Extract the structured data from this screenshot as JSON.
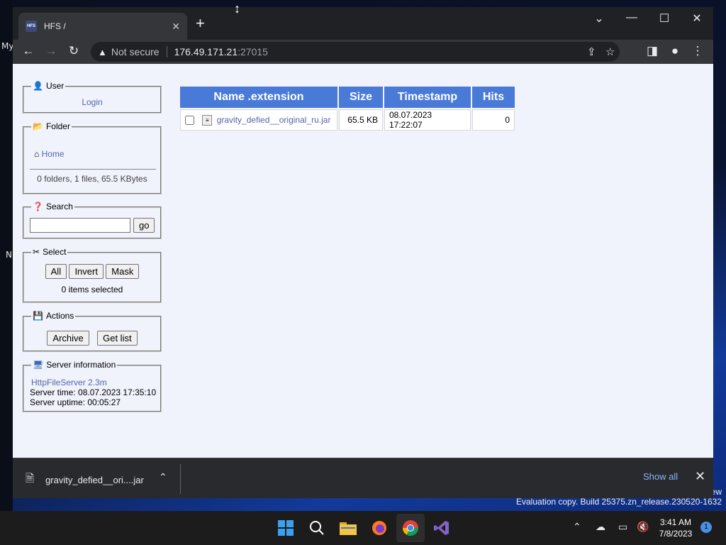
{
  "desktop": {
    "labels": [
      "My",
      "N"
    ],
    "eval_suffix": "ew",
    "eval_text": "Evaluation copy. Build 25375.zn_release.230520-1632"
  },
  "tab": {
    "title": "HFS /",
    "favicon_text": "HFS"
  },
  "address": {
    "security": "Not secure",
    "host": "176.49.171.21",
    "port": ":27015"
  },
  "sidebar": {
    "user": {
      "title": "User",
      "login": "Login"
    },
    "folder": {
      "title": "Folder",
      "home": "Home",
      "summary": "0 folders, 1 files, 65.5 KBytes"
    },
    "search": {
      "title": "Search",
      "value": "",
      "go": "go"
    },
    "select": {
      "title": "Select",
      "all": "All",
      "invert": "Invert",
      "mask": "Mask",
      "status": "0 items selected"
    },
    "actions": {
      "title": "Actions",
      "archive": "Archive",
      "get_list": "Get list"
    },
    "server": {
      "title": "Server information",
      "link": "HttpFileServer 2.3m",
      "time": "Server time: 08.07.2023 17:35:10",
      "uptime": "Server uptime: 00:05:27"
    }
  },
  "files": {
    "headers": [
      "Name .extension",
      "Size",
      "Timestamp",
      "Hits"
    ],
    "rows": [
      {
        "name": "gravity_defied__original_ru.jar",
        "size": "65.5 KB",
        "timestamp": "08.07.2023 17:22:07",
        "hits": "0"
      }
    ]
  },
  "download": {
    "file": "gravity_defied__ori....jar",
    "show_all": "Show all"
  },
  "taskbar": {
    "time": "3:41 AM",
    "date": "7/8/2023",
    "notifications": "1"
  },
  "colors": {
    "header_blue": "#4a7ad8",
    "link": "#5566aa",
    "page_bg": "#f0f2fc",
    "show_all": "#8ab4f8"
  }
}
